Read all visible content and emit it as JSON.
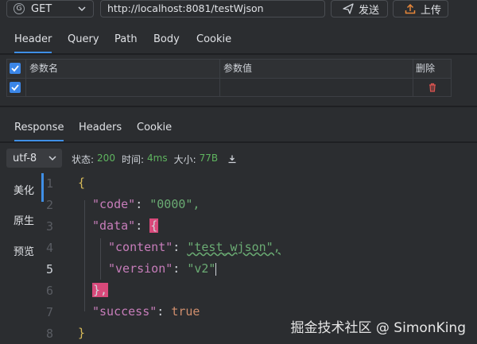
{
  "request": {
    "method_icon_letter": "G",
    "method": "GET",
    "url": "http://localhost:8081/testWjson",
    "send_label": "发送",
    "upload_label": "上传"
  },
  "request_tabs": [
    "Header",
    "Query",
    "Path",
    "Body",
    "Cookie"
  ],
  "params_table": {
    "headers": [
      "参数名",
      "参数值",
      "删除"
    ],
    "rows": [
      {
        "name": "",
        "value": ""
      }
    ]
  },
  "response_tabs": [
    "Response",
    "Headers",
    "Cookie"
  ],
  "response_meta": {
    "encoding": "utf-8",
    "status_label": "状态:",
    "status_value": "200",
    "time_label": "时间:",
    "time_value": "4ms",
    "size_label": "大小:",
    "size_value": "77B"
  },
  "view_tabs": [
    "美化",
    "原生",
    "预览"
  ],
  "code_lines": [
    {
      "n": "1",
      "text": "{"
    },
    {
      "n": "2",
      "key": "\"code\"",
      "value": "\"0000\","
    },
    {
      "n": "3",
      "key": "\"data\"",
      "value": "{"
    },
    {
      "n": "4",
      "key": "\"content\"",
      "value": "\"test_wjson\","
    },
    {
      "n": "5",
      "key": "\"version\"",
      "value": "\"v2\""
    },
    {
      "n": "6",
      "text": "},"
    },
    {
      "n": "7",
      "key": "\"success\"",
      "value": "true"
    },
    {
      "n": "8",
      "text": "}"
    }
  ],
  "watermark": "掘金技术社区 @ SimonKing",
  "colors": {
    "accent": "#3f8fe6",
    "status_green": "#5fb55f",
    "delete_red": "#d9534f",
    "json_key": "#c77dba",
    "json_string": "#6aab73",
    "bracket_match": "#d8497a"
  }
}
